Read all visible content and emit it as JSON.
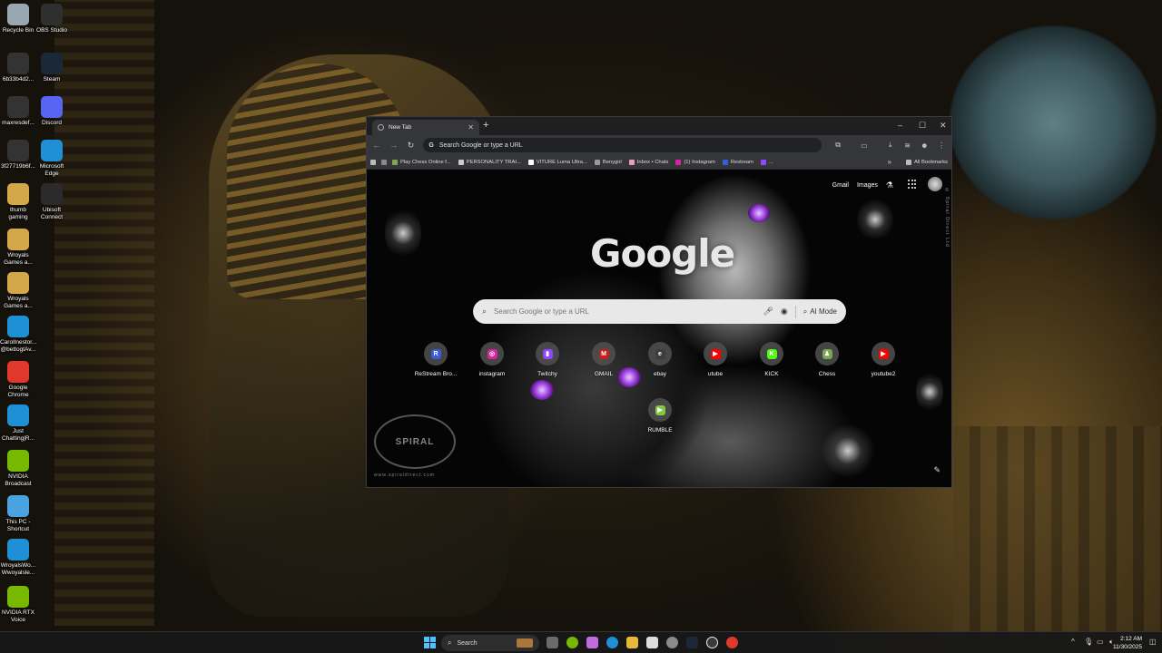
{
  "desktop_icons": [
    {
      "label": "Recycle Bin",
      "icon": "recycle-bin-icon",
      "color": "#9aa6b2"
    },
    {
      "label": "OBS Studio",
      "icon": "obs-icon",
      "color": "#2f2f2f"
    },
    {
      "label": "6b33b4d2...",
      "icon": "usb-icon",
      "color": "#333333"
    },
    {
      "label": "Steam",
      "icon": "steam-icon",
      "color": "#1b2838"
    },
    {
      "label": "maxresdef...",
      "icon": "usb-icon",
      "color": "#333333"
    },
    {
      "label": "Discord",
      "icon": "discord-icon",
      "color": "#5865f2"
    },
    {
      "label": "3f27719b6f...",
      "icon": "usb-icon",
      "color": "#333333"
    },
    {
      "label": "Microsoft Edge",
      "icon": "edge-icon",
      "color": "#1f8fd6"
    },
    {
      "label": "thumb gaming",
      "icon": "folder-icon",
      "color": "#d4a84a"
    },
    {
      "label": "Ubisoft Connect",
      "icon": "ubisoft-icon",
      "color": "#2b2b2b"
    },
    {
      "label": "Wroyals Games a...",
      "icon": "folder-icon",
      "color": "#d4a84a"
    },
    {
      "label": "Wroyals Games a...",
      "icon": "folder-icon",
      "color": "#d4a84a"
    },
    {
      "label": "CarolInestor... @bettogtAv...",
      "icon": "edge-icon",
      "color": "#1f8fd6"
    },
    {
      "label": "Google Chrome",
      "icon": "chrome-icon",
      "color": "#e0392b"
    },
    {
      "label": "Just Chatting|R...",
      "icon": "edge-icon",
      "color": "#1f8fd6"
    },
    {
      "label": "NVIDIA Broadcast",
      "icon": "nvidia-icon",
      "color": "#76b900"
    },
    {
      "label": "This PC - Shortcut",
      "icon": "monitor-icon",
      "color": "#4aa3df"
    },
    {
      "label": "WroyalsWo... Wwoyalsle...",
      "icon": "edge-icon",
      "color": "#1f8fd6"
    },
    {
      "label": "NVIDIA RTX Voice",
      "icon": "headphones-icon",
      "color": "#76b900"
    }
  ],
  "browser": {
    "tab_title": "New Tab",
    "new_tab": "+",
    "omnibox_placeholder": "Search Google or type a URL",
    "bookmarks": [
      "Play Chess Online f...",
      "PERSONALITY TRAI...",
      "VITURE Luma Ultra...",
      "Benygirl",
      "Inbox • Chats",
      "(1) Instagram",
      "Restream",
      "..."
    ],
    "bookmarks_more": "»",
    "all_bookmarks": "All Bookmarks"
  },
  "ntp": {
    "gmail": "Gmail",
    "images": "Images",
    "logo": "Google",
    "search_placeholder": "Search Google or type a URL",
    "ai_mode": "AI Mode",
    "side_watermark": "© Spiral Direct Ltd",
    "spiral": "SPIRAL",
    "spiral_url": "www.spiraldirect.com",
    "shortcuts": [
      {
        "label": "ReStream Bro...",
        "fav": "R",
        "color": "#3b5bdb"
      },
      {
        "label": "instagram",
        "fav": "◎",
        "color": "#d6249f"
      },
      {
        "label": "Twitchy",
        "fav": "▮",
        "color": "#9146ff"
      },
      {
        "label": "GMAIL",
        "fav": "M",
        "color": "#c5221f"
      },
      {
        "label": "ebay",
        "fav": "e",
        "color": "#3d3d3d"
      },
      {
        "label": "utube",
        "fav": "▶",
        "color": "#ff0000"
      },
      {
        "label": "KICK",
        "fav": "K",
        "color": "#53fc18"
      },
      {
        "label": "Chess",
        "fav": "♟",
        "color": "#7fa650"
      },
      {
        "label": "youtube2",
        "fav": "▶",
        "color": "#ff0000"
      },
      {
        "label": "RUMBLE",
        "fav": "▶",
        "color": "#85c742"
      }
    ]
  },
  "taskbar": {
    "search": "Search",
    "time": "2:12 AM",
    "date": "11/30/2025"
  }
}
